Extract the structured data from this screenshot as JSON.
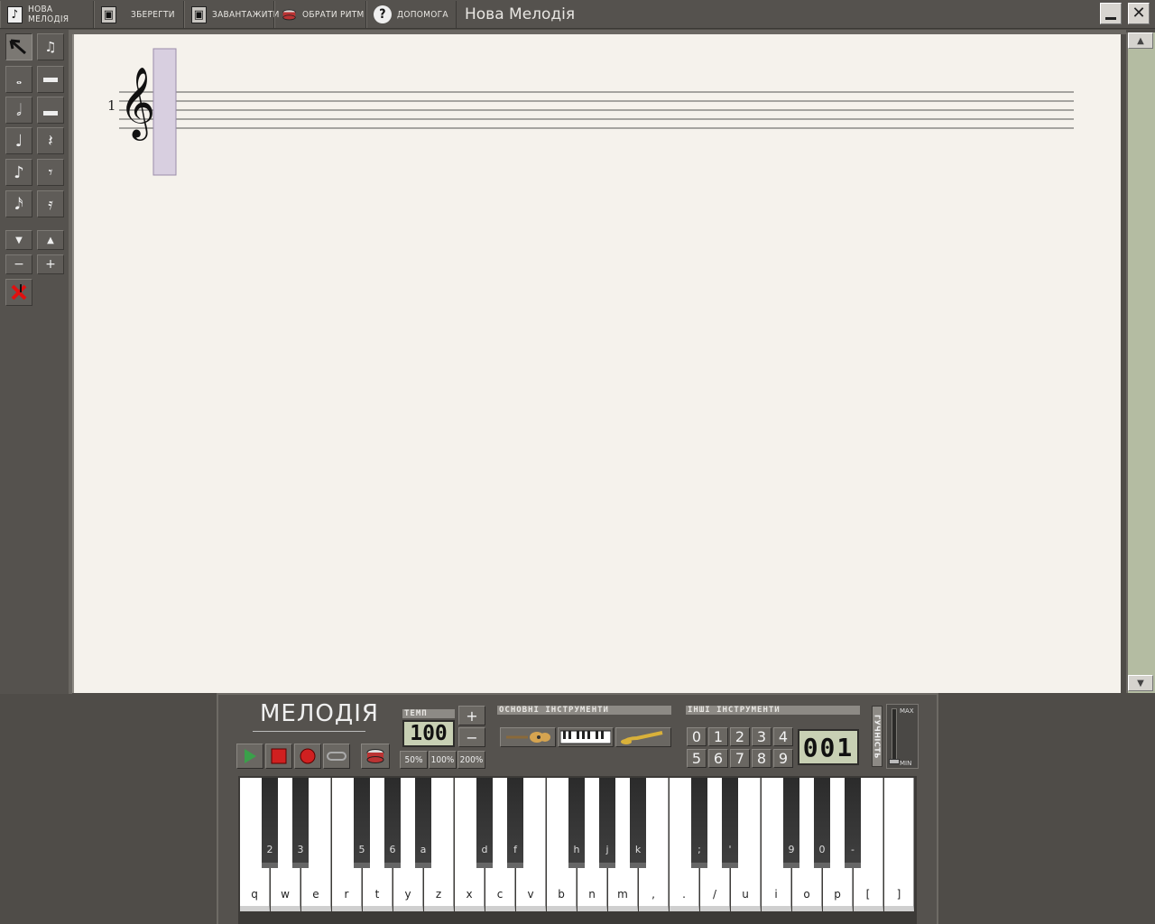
{
  "toolbar": {
    "new_melody": "Нова мелодія",
    "save": "Зберегти",
    "load": "Завантажити",
    "choose_rhythm": "Обрати ритм",
    "help": "Допомога"
  },
  "window": {
    "title": "Нова Мелодія",
    "minimize": "_",
    "close": "✕"
  },
  "palette": {
    "tools": [
      "pointer-tool",
      "chord-tool",
      "whole-note",
      "whole-rest",
      "half-note",
      "half-rest",
      "quarter-note",
      "quarter-rest",
      "eighth-note",
      "eighth-rest",
      "sixteenth-note",
      "sixteenth-rest"
    ],
    "pitch_down": "▼",
    "pitch_up": "▲",
    "minus": "−",
    "plus": "+"
  },
  "score": {
    "measure_number": "1",
    "clef": "𝄞"
  },
  "panel": {
    "logo": "МЕЛОДІЯ",
    "tempo_label": "ТЕМП",
    "tempo_value": "100",
    "tempo_plus": "+",
    "tempo_minus": "−",
    "speed_50": "50%",
    "speed_100": "100%",
    "speed_200": "200%",
    "main_instruments_label": "ОСНОВНІ ІНСТРУМЕНТИ",
    "other_instruments_label": "ІНШІ ІНСТРУМЕНТИ",
    "instrument_numbers": [
      "0",
      "1",
      "2",
      "3",
      "4",
      "5",
      "6",
      "7",
      "8",
      "9"
    ],
    "instrument_display": "001",
    "volume_label": "ГУЧНІСТЬ",
    "volume_max": "MAX",
    "volume_min": "MIN"
  },
  "keyboard": {
    "white_keys": [
      "q",
      "w",
      "e",
      "r",
      "t",
      "y",
      "z",
      "x",
      "c",
      "v",
      "b",
      "n",
      "m",
      ",",
      ".",
      "/",
      "u",
      "i",
      "o",
      "p",
      "[",
      "]"
    ],
    "black_keys": [
      "2",
      "3",
      "5",
      "6",
      "a",
      "d",
      "f",
      "h",
      "j",
      "k",
      ";",
      "'",
      "9",
      "0",
      "-"
    ]
  }
}
